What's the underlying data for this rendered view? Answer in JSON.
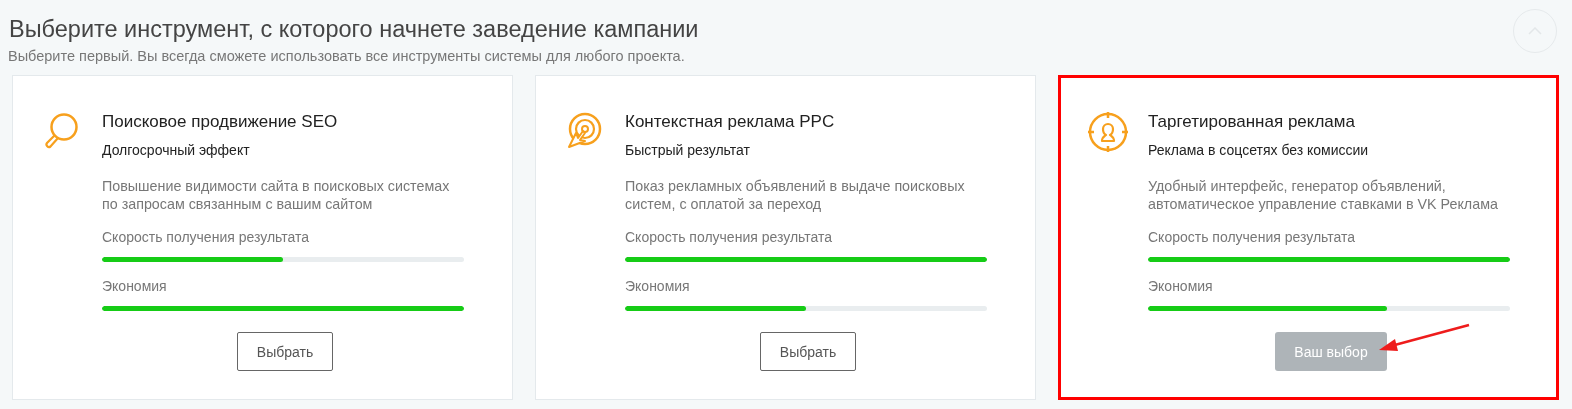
{
  "heading": {
    "title": "Выберите инструмент, с которого начнете заведение кампании",
    "subtitle": "Выберите первый. Вы всегда сможете использовать все инструменты системы для любого проекта."
  },
  "cards": [
    {
      "kind": "search",
      "title": "Поисковое продвижение SEO",
      "tagline": "Долгосрочный эффект",
      "description": "Повышение видимости сайта в поисковых системах по запросам связанным с вашим сайтом",
      "metrics": [
        {
          "label": "Скорость получения результата",
          "level": 0.5
        },
        {
          "label": "Экономия",
          "level": 1
        }
      ],
      "button": "Выбрать",
      "selected": false
    },
    {
      "kind": "click",
      "title": "Контекстная реклама PPC",
      "tagline": "Быстрый результат",
      "description": "Показ рекламных объявлений в выдаче поисковых систем, с оплатой за переход",
      "metrics": [
        {
          "label": "Скорость получения результата",
          "level": 1
        },
        {
          "label": "Экономия",
          "level": 0.5
        }
      ],
      "button": "Выбрать",
      "selected": false
    },
    {
      "kind": "target",
      "title": "Таргетированная реклама",
      "tagline": "Реклама в соцсетях без комиссии",
      "description": "Удобный интерфейс, генератор объявлений, автоматическое управление ставками в VK Реклама",
      "metrics": [
        {
          "label": "Скорость получения результата",
          "level": 1
        },
        {
          "label": "Экономия",
          "level": 0.66
        }
      ],
      "button": "Ваш выбор",
      "selected": true
    }
  ]
}
